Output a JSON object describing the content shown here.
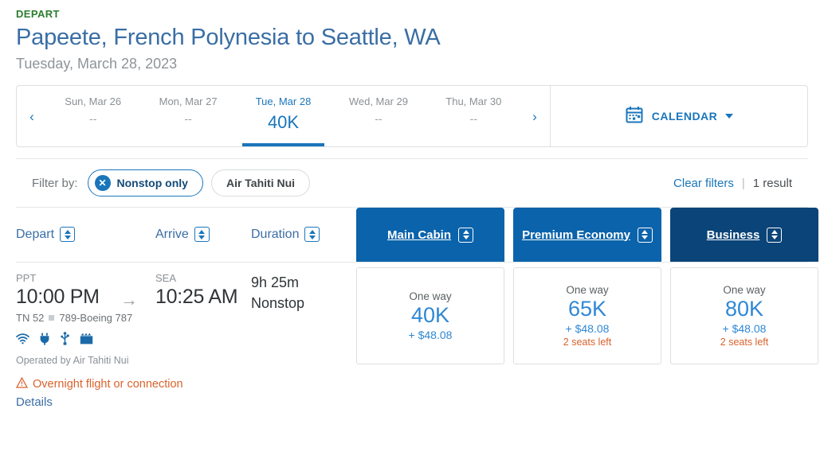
{
  "header": {
    "eyebrow": "DEPART",
    "route": "Papeete, French Polynesia to Seattle, WA",
    "date": "Tuesday, March 28, 2023"
  },
  "datestrip": {
    "prev_icon": "‹",
    "next_icon": "›",
    "days": [
      {
        "label": "Sun, Mar 26",
        "price": "--",
        "active": false
      },
      {
        "label": "Mon, Mar 27",
        "price": "--",
        "active": false
      },
      {
        "label": "Tue, Mar 28",
        "price": "40K",
        "active": true
      },
      {
        "label": "Wed, Mar 29",
        "price": "--",
        "active": false
      },
      {
        "label": "Thu, Mar 30",
        "price": "--",
        "active": false
      }
    ],
    "calendar_label": "CALENDAR"
  },
  "filters": {
    "label": "Filter by:",
    "chips": [
      {
        "label": "Nonstop only",
        "active": true
      },
      {
        "label": "Air Tahiti Nui",
        "active": false
      }
    ],
    "clear_label": "Clear filters",
    "separator": "|",
    "result_count": "1 result"
  },
  "columns": {
    "depart": "Depart",
    "arrive": "Arrive",
    "duration": "Duration"
  },
  "fare_tabs": [
    {
      "label": "Main Cabin",
      "color": "#0b63ab"
    },
    {
      "label": "Premium Economy",
      "color": "#0b63ab"
    },
    {
      "label": "Business",
      "color": "#0a4478"
    }
  ],
  "flight": {
    "depart_code": "PPT",
    "depart_time": "10:00 PM",
    "arrow": "→",
    "arrive_code": "SEA",
    "arrive_time": "10:25 AM",
    "duration": "9h 25m",
    "stops": "Nonstop",
    "flight_number": "TN 52",
    "aircraft": "789-Boeing 787",
    "amenities": [
      "wifi-icon",
      "power-outlet-icon",
      "usb-port-icon",
      "entertainment-icon"
    ],
    "operated_by": "Operated by Air Tahiti Nui",
    "overnight_warning": "Overnight flight or connection",
    "details_label": "Details"
  },
  "fares": [
    {
      "oneway": "One way",
      "miles": "40K",
      "cash": "+ $48.08",
      "seats": ""
    },
    {
      "oneway": "One way",
      "miles": "65K",
      "cash": "+ $48.08",
      "seats": "2 seats left"
    },
    {
      "oneway": "One way",
      "miles": "80K",
      "cash": "+ $48.08",
      "seats": "2 seats left"
    }
  ],
  "colors": {
    "brand_blue": "#1a76bb",
    "title_blue": "#3a6ea5",
    "green": "#2a7d2e",
    "orange": "#d9622b",
    "business_navy": "#0a4478"
  }
}
